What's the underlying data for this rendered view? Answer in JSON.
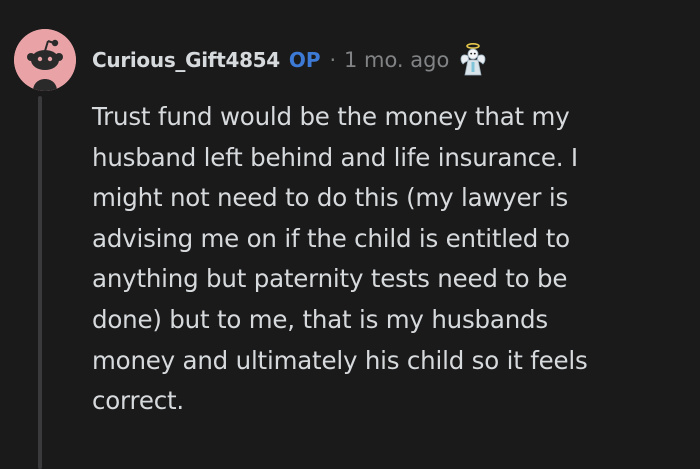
{
  "comment": {
    "username": "Curious_Gift4854",
    "op_badge": "OP",
    "separator": "·",
    "timestamp": "1 mo. ago",
    "avatar_icon": "reddit-snoo-avatar-icon",
    "award_icon": "angel-award-icon",
    "colors": {
      "background": "#1a1a1b",
      "text": "#d7dadc",
      "op": "#3d7ad6",
      "meta": "#818384",
      "avatar_bg": "#e9a3a6"
    },
    "body_lines": [
      "Trust fund would be the money that my",
      "husband left behind and life insurance. I",
      "might not need to do this (my lawyer is",
      "advising me on if the child is entitled to",
      "anything but paternity tests need to be",
      "done) but to me, that is my husbands",
      "money and ultimately his child so it feels",
      "correct."
    ]
  }
}
